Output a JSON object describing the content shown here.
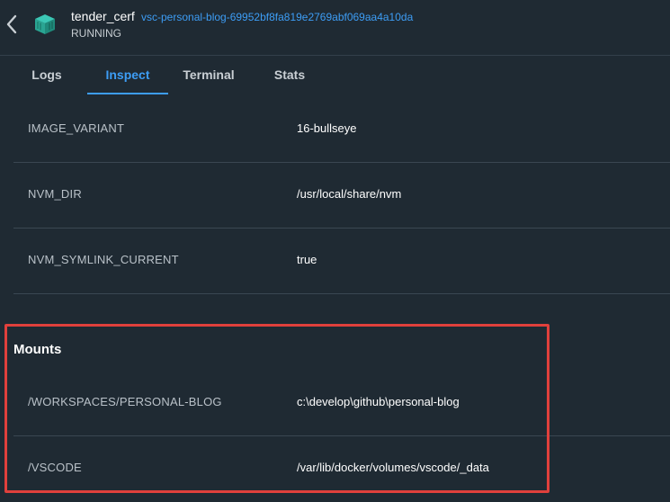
{
  "header": {
    "container_name": "tender_cerf",
    "image_name": "vsc-personal-blog-69952bf8fa819e2769abf069aa4a10da",
    "status": "RUNNING"
  },
  "tabs": [
    {
      "label": "Logs"
    },
    {
      "label": "Inspect",
      "active": true
    },
    {
      "label": "Terminal"
    },
    {
      "label": "Stats"
    }
  ],
  "env": [
    {
      "key": "IMAGE_VARIANT",
      "value": "16-bullseye"
    },
    {
      "key": "NVM_DIR",
      "value": "/usr/local/share/nvm"
    },
    {
      "key": "NVM_SYMLINK_CURRENT",
      "value": "true"
    }
  ],
  "mounts": {
    "title": "Mounts",
    "items": [
      {
        "key": "/WORKSPACES/PERSONAL-BLOG",
        "value": "c:\\develop\\github\\personal-blog"
      },
      {
        "key": "/VSCODE",
        "value": "/var/lib/docker/volumes/vscode/_data"
      }
    ]
  },
  "colors": {
    "background": "#1f2a33",
    "accent": "#3d9df5",
    "highlight": "#e0403c"
  }
}
